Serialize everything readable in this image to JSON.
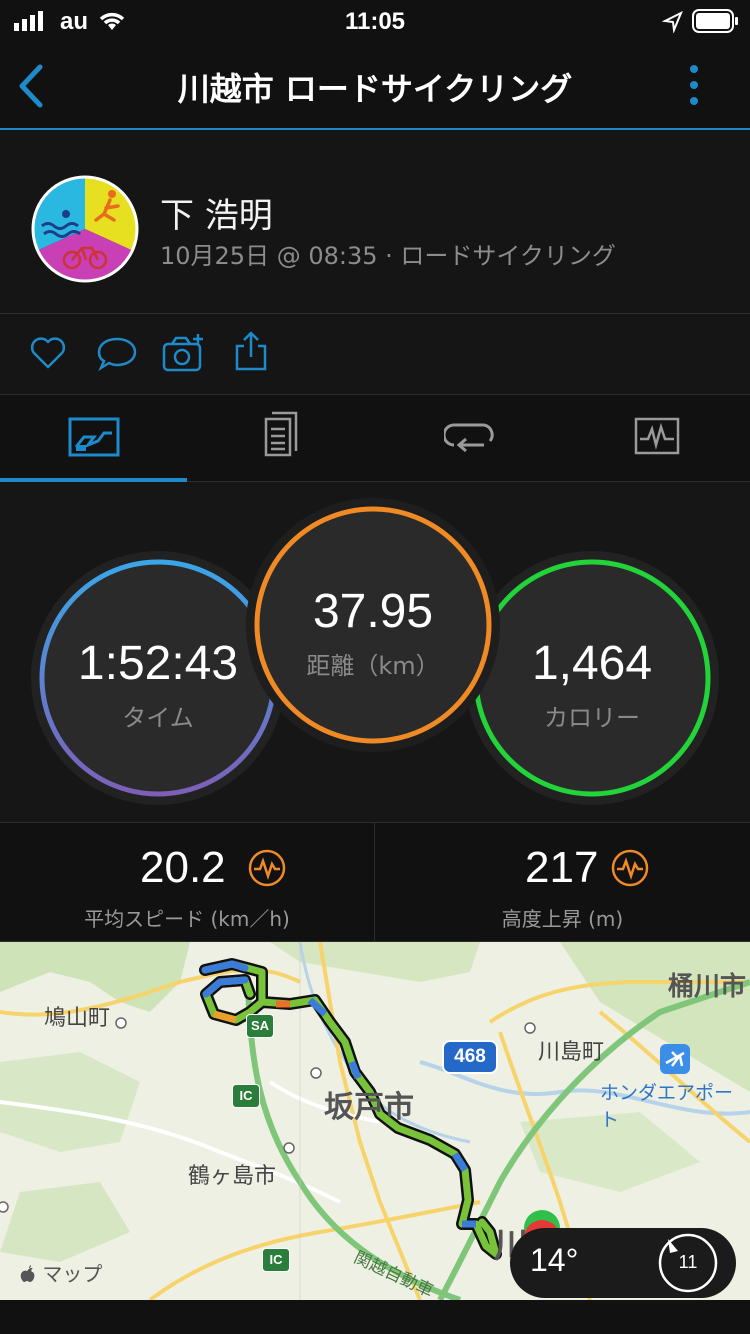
{
  "status_bar": {
    "carrier": "au",
    "time": "11:05"
  },
  "nav": {
    "title": "川越市 ロードサイクリング",
    "back_icon": "chevron-left-icon",
    "more_icon": "vertical-ellipsis-icon",
    "accent": "#1f8ac9"
  },
  "profile": {
    "name": "下 浩明",
    "meta": "10月25日 @ 08:35 · ロードサイクリング",
    "avatar_colors": [
      "#2ab8e0",
      "#e6e021",
      "#c93fb5"
    ]
  },
  "actions": [
    "heart-icon",
    "comment-icon",
    "camera-add-icon",
    "share-icon"
  ],
  "tabs": [
    "overview-tab",
    "details-tab",
    "laps-tab",
    "charts-tab"
  ],
  "stats": {
    "time": {
      "value": "1:52:43",
      "label": "タイム"
    },
    "distance": {
      "value": "37.95",
      "label": "距離（km）"
    },
    "calories": {
      "value": "1,464",
      "label": "カロリー"
    },
    "colors": {
      "distance": "#f08a24",
      "calories": "#22d33a",
      "time_top": "#3aa6e8",
      "time_bottom": "#7d5fb8"
    }
  },
  "secondary": {
    "speed": {
      "value": "20.2",
      "label": "平均スピード (km／h)"
    },
    "elevation": {
      "value": "217",
      "label": "高度上昇 (m)"
    }
  },
  "map": {
    "labels": {
      "hatoyama": "鳩山町",
      "okegawa": "桶川市",
      "kawajima": "川島町",
      "honda": "ホンダエアポート",
      "sakado": "坂戸市",
      "tsurugashima": "鶴ヶ島市",
      "expressway": "関越自動車",
      "route": "468",
      "sa": "SA",
      "ic1": "IC",
      "ic2": "IC",
      "kawa": "川"
    },
    "attribution": "マップ",
    "weather": {
      "temp": "14°",
      "wind": "11"
    }
  }
}
